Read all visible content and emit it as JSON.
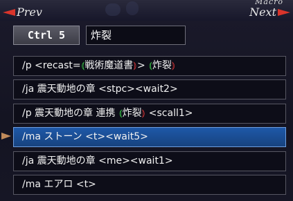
{
  "header": {
    "prev_label": "Prev",
    "next_label": "Next",
    "frame_title": "Macro"
  },
  "macro": {
    "slot_label": "Ctrl 5",
    "name_value": "炸裂"
  },
  "lines": [
    {
      "parts": [
        {
          "text": "/p <recast="
        },
        {
          "text": "戦術魔道書",
          "autotranslate": true
        },
        {
          "text": "> "
        },
        {
          "text": "炸裂",
          "autotranslate": true
        }
      ]
    },
    {
      "parts": [
        {
          "text": "/ja 震天動地の章 <stpc><wait2>"
        }
      ]
    },
    {
      "parts": [
        {
          "text": "/p 震天動地の章 連携 "
        },
        {
          "text": "炸裂",
          "autotranslate": true
        },
        {
          "text": " <scall1>"
        }
      ]
    },
    {
      "parts": [
        {
          "text": "/ma ストーン <t><wait5>"
        }
      ],
      "selected": true
    },
    {
      "parts": [
        {
          "text": "/ja 震天動地の章 <me><wait1>"
        }
      ]
    },
    {
      "parts": [
        {
          "text": "/ma エアロ <t>"
        }
      ]
    }
  ],
  "colors": {
    "selected_bg": "#1e58a8",
    "autotranslate_open": "#3cd24a",
    "autotranslate_close": "#e83a3a",
    "nav_arrow": "#d9342b"
  }
}
